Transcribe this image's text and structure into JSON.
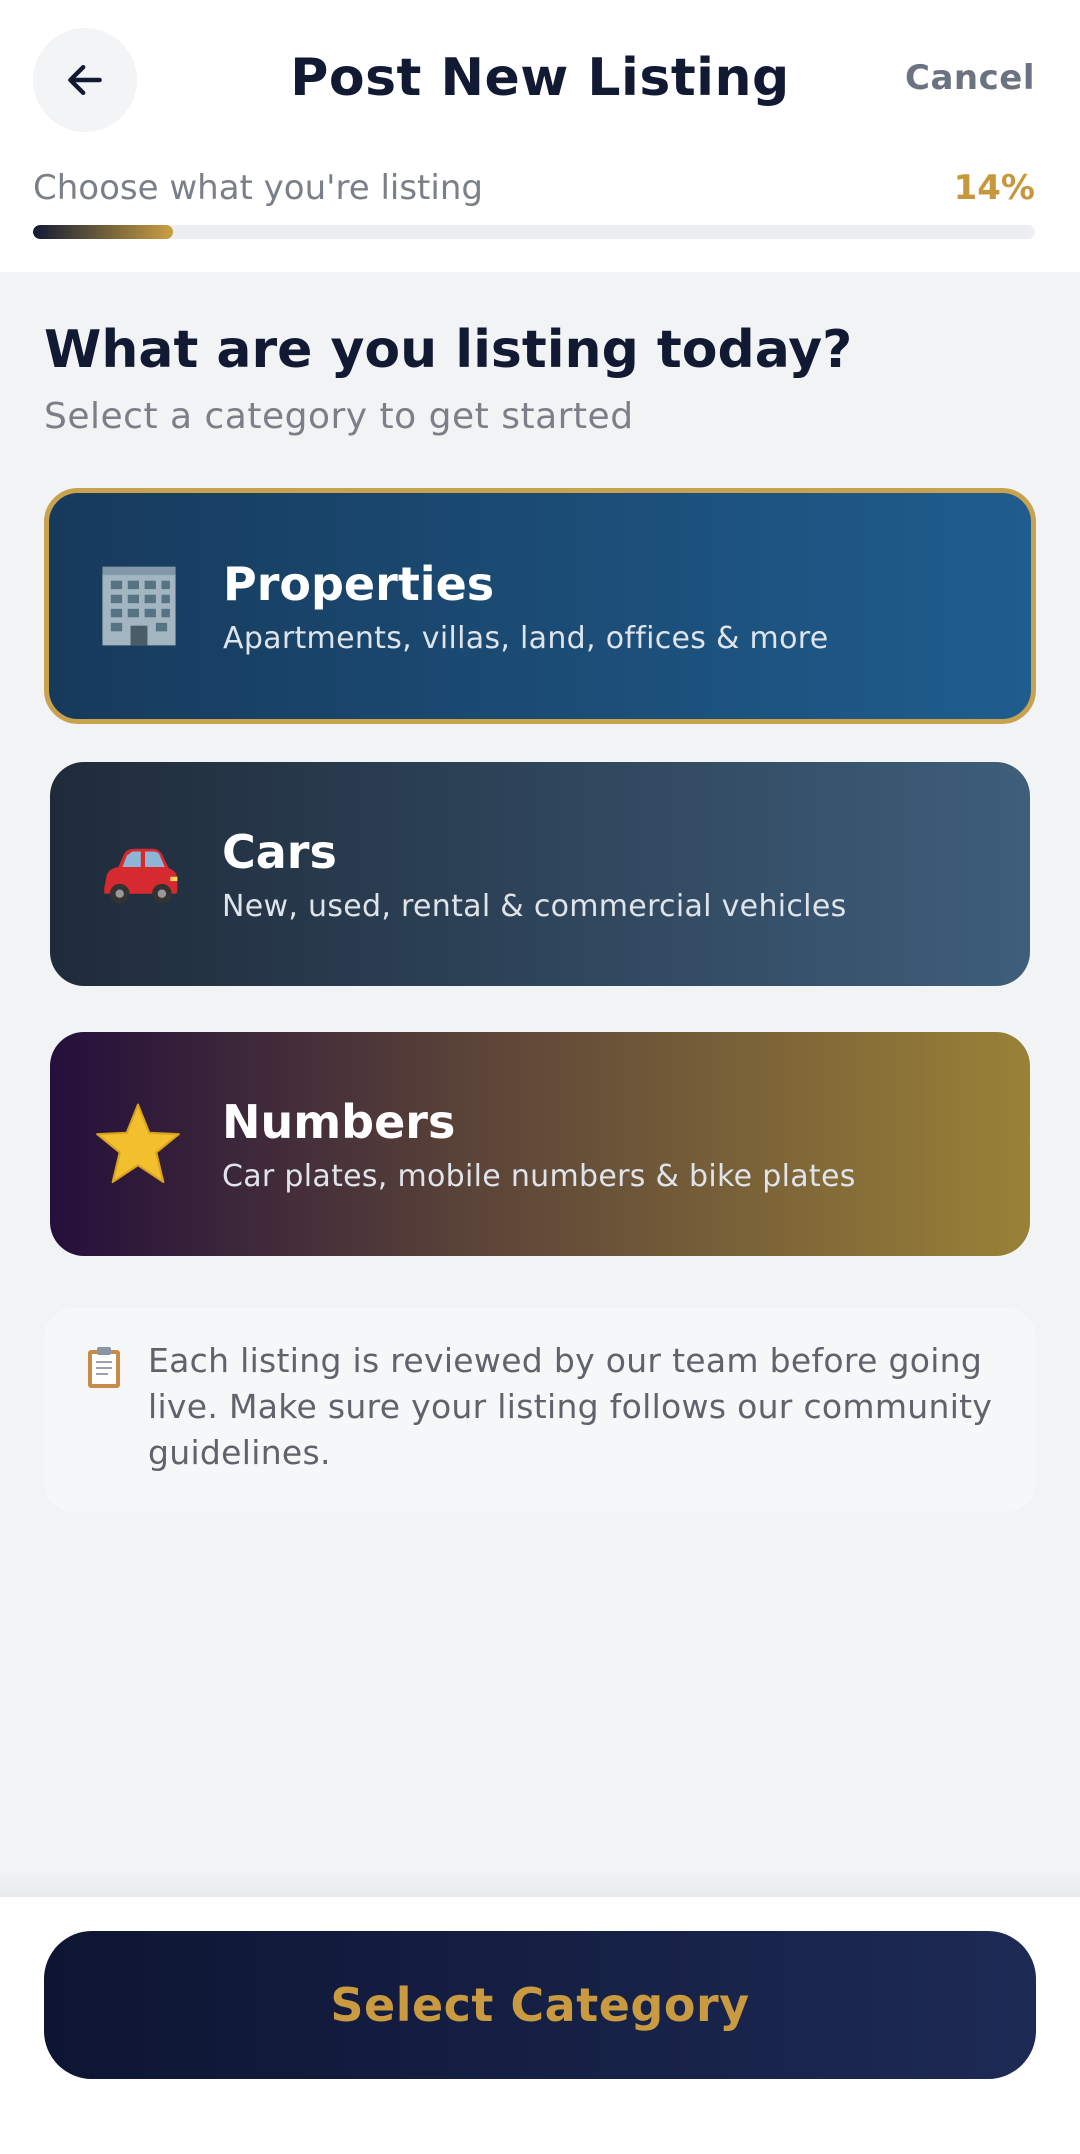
{
  "header": {
    "title": "Post New Listing",
    "cancel_label": "Cancel",
    "back_icon": "arrow-left-icon"
  },
  "progress": {
    "step_label": "Choose what you're listing",
    "percent_label": "14%",
    "value": 0.14
  },
  "main": {
    "heading": "What are you listing today?",
    "subheading": "Select a category to get started"
  },
  "categories": [
    {
      "title": "Properties",
      "subtitle": "Apartments, villas, land, offices & more",
      "icon": "office-building-icon",
      "selected": true
    },
    {
      "title": "Cars",
      "subtitle": "New, used, rental & commercial vehicles",
      "icon": "car-icon",
      "selected": false
    },
    {
      "title": "Numbers",
      "subtitle": "Car plates, mobile numbers & bike plates",
      "icon": "star-icon",
      "selected": false
    }
  ],
  "notice": {
    "icon": "clipboard-icon",
    "text": "Each listing is reviewed by our team before going live. Make sure your listing follows our community guidelines."
  },
  "footer": {
    "cta_label": "Select Category"
  },
  "colors": {
    "accent": "#c99a40",
    "navy": "#121a33"
  }
}
